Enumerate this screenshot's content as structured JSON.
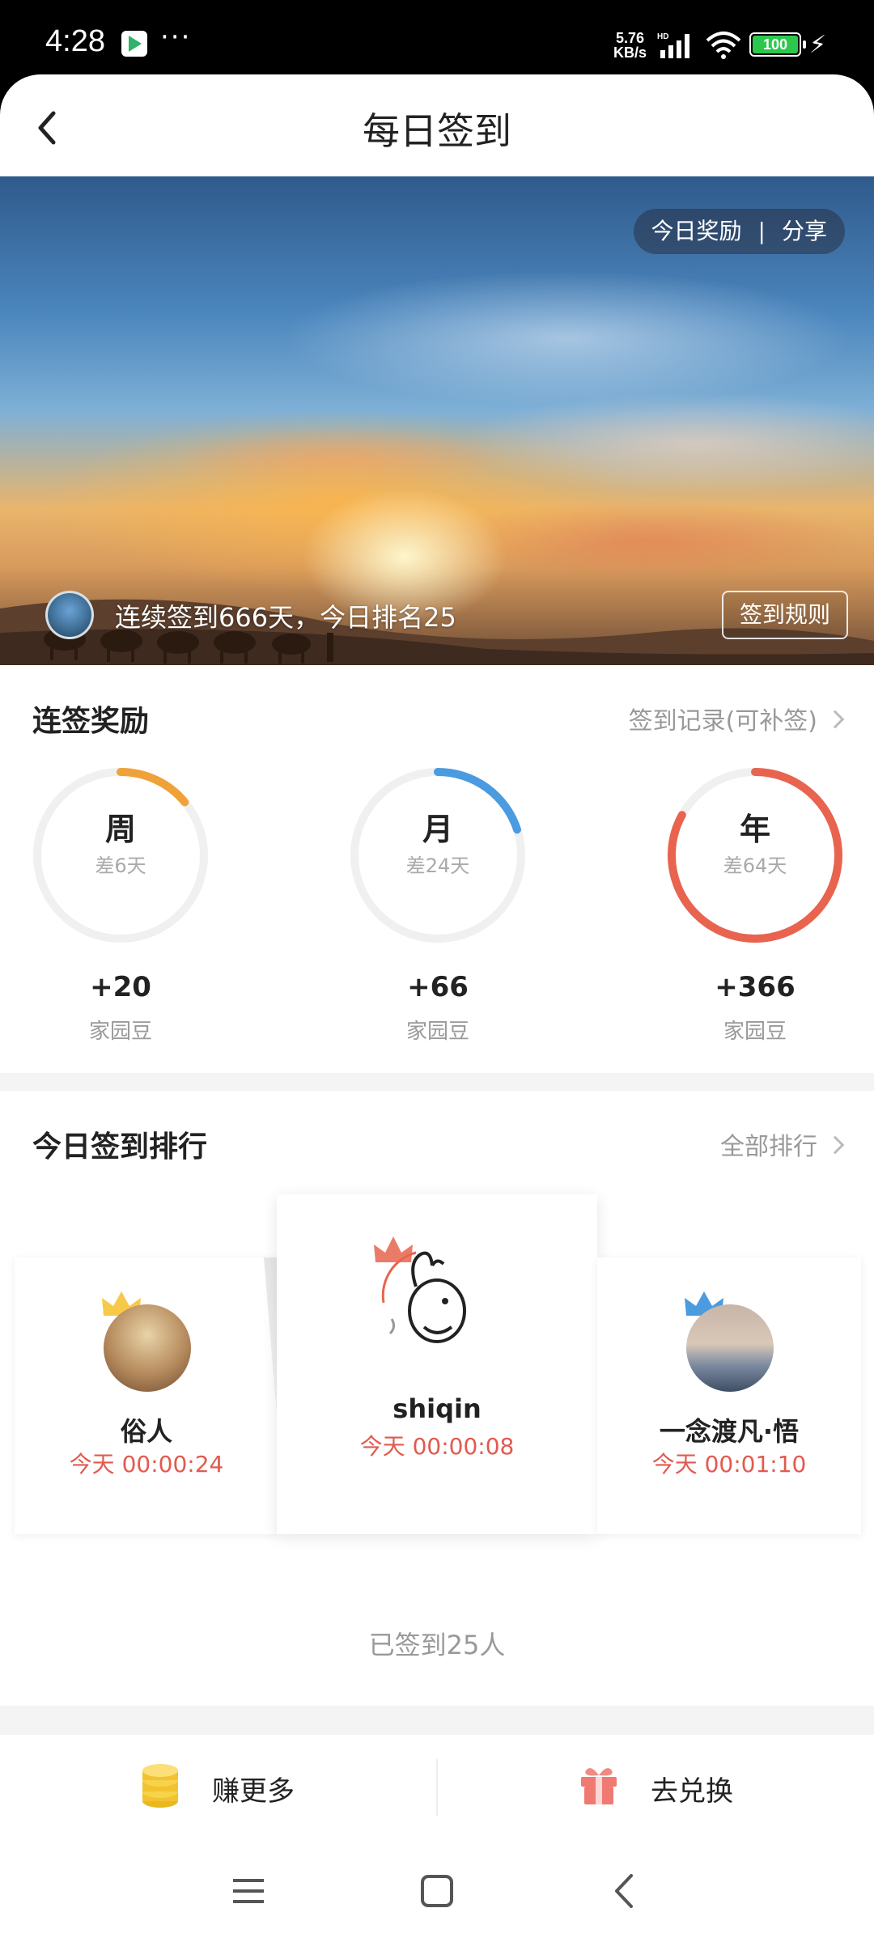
{
  "status_bar": {
    "time": "4:28",
    "dots": "···",
    "net_speed_value": "5.76",
    "net_speed_unit": "KB/s",
    "battery": "100"
  },
  "header": {
    "title": "每日签到"
  },
  "banner": {
    "today_reward": "今日奖励",
    "separator": "|",
    "share": "分享",
    "streak_text": "连续签到666天，今日排名25",
    "rules_button": "签到规则"
  },
  "streak": {
    "title": "连签奖励",
    "records_link": "签到记录(可补签)",
    "rewards": [
      {
        "label": "周",
        "remaining": "差6天",
        "amount": "+20",
        "unit": "家园豆",
        "progress": 0.14,
        "color": "#f0a23a"
      },
      {
        "label": "月",
        "remaining": "差24天",
        "amount": "+66",
        "unit": "家园豆",
        "progress": 0.2,
        "color": "#4a9be0"
      },
      {
        "label": "年",
        "remaining": "差64天",
        "amount": "+366",
        "unit": "家园豆",
        "progress": 0.83,
        "color": "#e8644f"
      }
    ]
  },
  "ranking": {
    "title": "今日签到排行",
    "all_link": "全部排行",
    "first": {
      "name": "shiqin",
      "time": "今天 00:00:08"
    },
    "second": {
      "name": "俗人",
      "time": "今天 00:00:24"
    },
    "third": {
      "name": "一念渡凡·悟",
      "time": "今天 00:01:10"
    },
    "signed_count": "已签到25人"
  },
  "actions": {
    "earn_more": "赚更多",
    "redeem": "去兑换"
  },
  "colors": {
    "accent_red": "#e25a4f",
    "gold": "#f2c230",
    "silver_crown": "#f7c948",
    "bronze_crown": "#4a9be0"
  }
}
